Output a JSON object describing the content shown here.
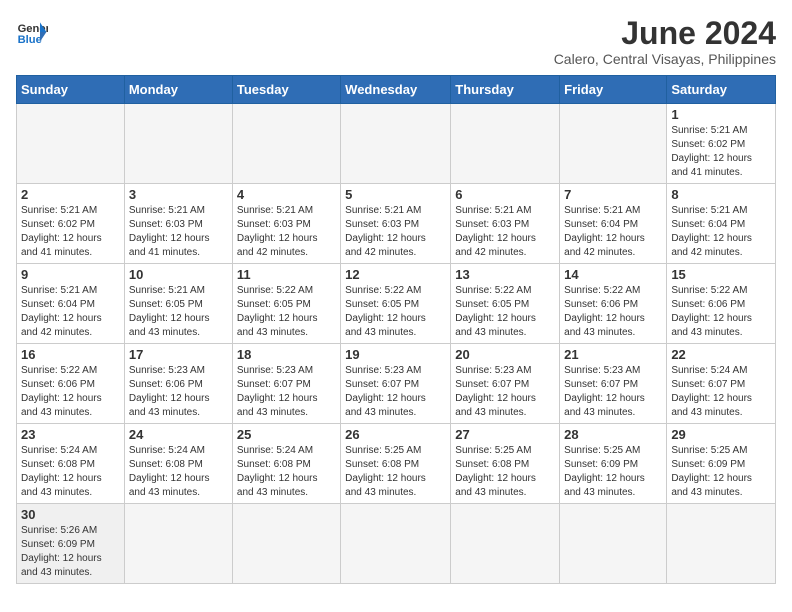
{
  "logo": {
    "line1": "General",
    "line2": "Blue"
  },
  "title": "June 2024",
  "subtitle": "Calero, Central Visayas, Philippines",
  "days_header": [
    "Sunday",
    "Monday",
    "Tuesday",
    "Wednesday",
    "Thursday",
    "Friday",
    "Saturday"
  ],
  "weeks": [
    [
      {
        "day": "",
        "info": ""
      },
      {
        "day": "",
        "info": ""
      },
      {
        "day": "",
        "info": ""
      },
      {
        "day": "",
        "info": ""
      },
      {
        "day": "",
        "info": ""
      },
      {
        "day": "",
        "info": ""
      },
      {
        "day": "1",
        "info": "Sunrise: 5:21 AM\nSunset: 6:02 PM\nDaylight: 12 hours\nand 41 minutes."
      }
    ],
    [
      {
        "day": "2",
        "info": "Sunrise: 5:21 AM\nSunset: 6:02 PM\nDaylight: 12 hours\nand 41 minutes."
      },
      {
        "day": "3",
        "info": "Sunrise: 5:21 AM\nSunset: 6:03 PM\nDaylight: 12 hours\nand 41 minutes."
      },
      {
        "day": "4",
        "info": "Sunrise: 5:21 AM\nSunset: 6:03 PM\nDaylight: 12 hours\nand 42 minutes."
      },
      {
        "day": "5",
        "info": "Sunrise: 5:21 AM\nSunset: 6:03 PM\nDaylight: 12 hours\nand 42 minutes."
      },
      {
        "day": "6",
        "info": "Sunrise: 5:21 AM\nSunset: 6:03 PM\nDaylight: 12 hours\nand 42 minutes."
      },
      {
        "day": "7",
        "info": "Sunrise: 5:21 AM\nSunset: 6:04 PM\nDaylight: 12 hours\nand 42 minutes."
      },
      {
        "day": "8",
        "info": "Sunrise: 5:21 AM\nSunset: 6:04 PM\nDaylight: 12 hours\nand 42 minutes."
      }
    ],
    [
      {
        "day": "9",
        "info": "Sunrise: 5:21 AM\nSunset: 6:04 PM\nDaylight: 12 hours\nand 42 minutes."
      },
      {
        "day": "10",
        "info": "Sunrise: 5:21 AM\nSunset: 6:05 PM\nDaylight: 12 hours\nand 43 minutes."
      },
      {
        "day": "11",
        "info": "Sunrise: 5:22 AM\nSunset: 6:05 PM\nDaylight: 12 hours\nand 43 minutes."
      },
      {
        "day": "12",
        "info": "Sunrise: 5:22 AM\nSunset: 6:05 PM\nDaylight: 12 hours\nand 43 minutes."
      },
      {
        "day": "13",
        "info": "Sunrise: 5:22 AM\nSunset: 6:05 PM\nDaylight: 12 hours\nand 43 minutes."
      },
      {
        "day": "14",
        "info": "Sunrise: 5:22 AM\nSunset: 6:06 PM\nDaylight: 12 hours\nand 43 minutes."
      },
      {
        "day": "15",
        "info": "Sunrise: 5:22 AM\nSunset: 6:06 PM\nDaylight: 12 hours\nand 43 minutes."
      }
    ],
    [
      {
        "day": "16",
        "info": "Sunrise: 5:22 AM\nSunset: 6:06 PM\nDaylight: 12 hours\nand 43 minutes."
      },
      {
        "day": "17",
        "info": "Sunrise: 5:23 AM\nSunset: 6:06 PM\nDaylight: 12 hours\nand 43 minutes."
      },
      {
        "day": "18",
        "info": "Sunrise: 5:23 AM\nSunset: 6:07 PM\nDaylight: 12 hours\nand 43 minutes."
      },
      {
        "day": "19",
        "info": "Sunrise: 5:23 AM\nSunset: 6:07 PM\nDaylight: 12 hours\nand 43 minutes."
      },
      {
        "day": "20",
        "info": "Sunrise: 5:23 AM\nSunset: 6:07 PM\nDaylight: 12 hours\nand 43 minutes."
      },
      {
        "day": "21",
        "info": "Sunrise: 5:23 AM\nSunset: 6:07 PM\nDaylight: 12 hours\nand 43 minutes."
      },
      {
        "day": "22",
        "info": "Sunrise: 5:24 AM\nSunset: 6:07 PM\nDaylight: 12 hours\nand 43 minutes."
      }
    ],
    [
      {
        "day": "23",
        "info": "Sunrise: 5:24 AM\nSunset: 6:08 PM\nDaylight: 12 hours\nand 43 minutes."
      },
      {
        "day": "24",
        "info": "Sunrise: 5:24 AM\nSunset: 6:08 PM\nDaylight: 12 hours\nand 43 minutes."
      },
      {
        "day": "25",
        "info": "Sunrise: 5:24 AM\nSunset: 6:08 PM\nDaylight: 12 hours\nand 43 minutes."
      },
      {
        "day": "26",
        "info": "Sunrise: 5:25 AM\nSunset: 6:08 PM\nDaylight: 12 hours\nand 43 minutes."
      },
      {
        "day": "27",
        "info": "Sunrise: 5:25 AM\nSunset: 6:08 PM\nDaylight: 12 hours\nand 43 minutes."
      },
      {
        "day": "28",
        "info": "Sunrise: 5:25 AM\nSunset: 6:09 PM\nDaylight: 12 hours\nand 43 minutes."
      },
      {
        "day": "29",
        "info": "Sunrise: 5:25 AM\nSunset: 6:09 PM\nDaylight: 12 hours\nand 43 minutes."
      }
    ],
    [
      {
        "day": "30",
        "info": "Sunrise: 5:26 AM\nSunset: 6:09 PM\nDaylight: 12 hours\nand 43 minutes."
      },
      {
        "day": "",
        "info": ""
      },
      {
        "day": "",
        "info": ""
      },
      {
        "day": "",
        "info": ""
      },
      {
        "day": "",
        "info": ""
      },
      {
        "day": "",
        "info": ""
      },
      {
        "day": "",
        "info": ""
      }
    ]
  ]
}
